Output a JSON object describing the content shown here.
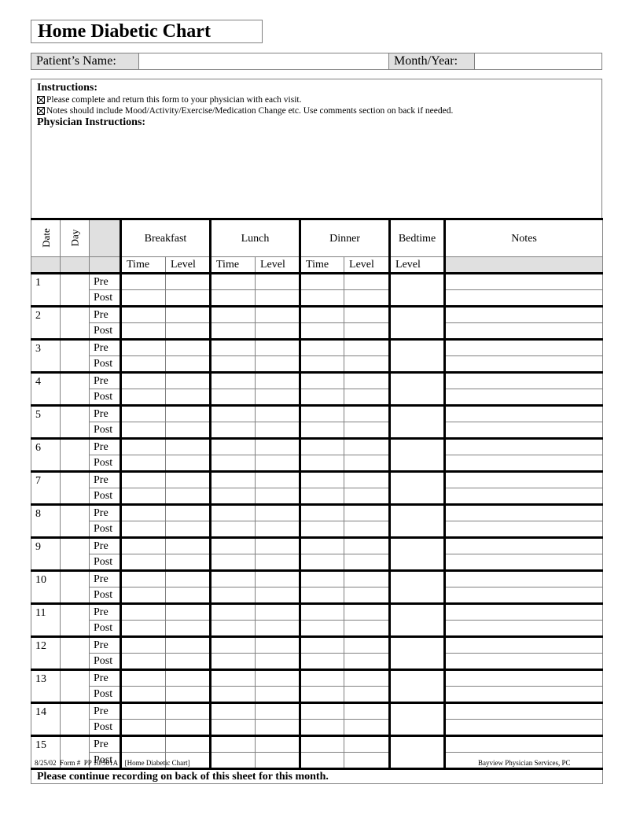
{
  "title": "Home Diabetic Chart",
  "patient_name": {
    "label": "Patient’s Name:",
    "value": ""
  },
  "month_year": {
    "label": "Month/Year:",
    "value": ""
  },
  "instructions": {
    "heading": "Instructions:",
    "items": [
      {
        "checked": true,
        "icon": "checked-box-icon",
        "text": "Please complete and return this form to your physician with each visit."
      },
      {
        "checked": true,
        "icon": "checked-box-icon",
        "text": "Notes should include Mood/Activity/Exercise/Medication Change etc.  Use comments section on back if needed."
      }
    ],
    "physician_heading": "Physician Instructions:",
    "physician_text": ""
  },
  "table": {
    "headers": {
      "date": "Date",
      "day": "Day",
      "breakfast": "Breakfast",
      "lunch": "Lunch",
      "dinner": "Dinner",
      "bedtime": "Bedtime",
      "notes": "Notes"
    },
    "subheaders": {
      "breakfast_time": "Time",
      "breakfast_level": "Level",
      "lunch_time": "Time",
      "lunch_level": "Level",
      "dinner_time": "Time",
      "dinner_level": "Level",
      "bedtime_level": "Level"
    },
    "pre_label": "Pre",
    "post_label": "Post",
    "days": [
      "1",
      "2",
      "3",
      "4",
      "5",
      "6",
      "7",
      "8",
      "9",
      "10",
      "11",
      "12",
      "13",
      "14",
      "15"
    ],
    "bottom_note": "Please continue recording on back of this sheet for this month."
  },
  "footer": {
    "left": "8/25/02  Form #  PP 10/501A    [Home Diabetic Chart]",
    "right": "Bayview Physician Services, PC"
  }
}
